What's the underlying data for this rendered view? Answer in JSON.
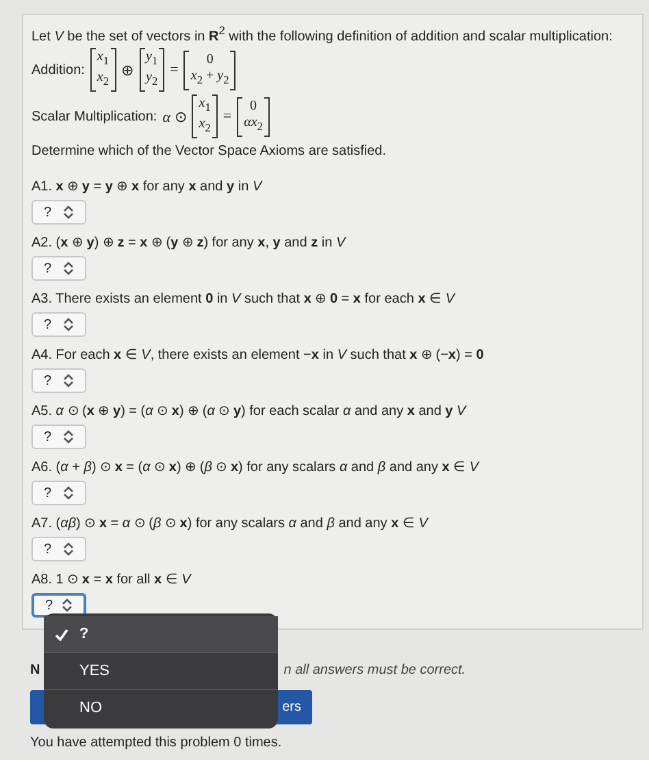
{
  "intro": "Let *V* be the set of vectors in **R**$^{2}$ with the following definition of addition and scalar multiplication:",
  "definitions": [
    {
      "label": "Addition:",
      "terms": [
        {
          "kind": "matrix",
          "entries": [
            "*x*$_{1}$",
            "*x*$_{2}$"
          ]
        },
        {
          "kind": "symbol",
          "text": "⊕"
        },
        {
          "kind": "matrix",
          "entries": [
            "*y*$_{1}$",
            "*y*$_{2}$"
          ]
        },
        {
          "kind": "symbol",
          "text": "="
        },
        {
          "kind": "matrix",
          "entries": [
            "0",
            "*x*$_{2}$ + *y*$_{2}$"
          ]
        }
      ]
    },
    {
      "label": "Scalar Multiplication:",
      "terms": [
        {
          "kind": "symbol",
          "text": "*α* ⊙"
        },
        {
          "kind": "matrix",
          "entries": [
            "*x*$_{1}$",
            "*x*$_{2}$"
          ]
        },
        {
          "kind": "symbol",
          "text": "="
        },
        {
          "kind": "matrix",
          "entries": [
            "0",
            "*αx*$_{2}$"
          ]
        }
      ]
    }
  ],
  "instruction": "Determine which of the Vector Space Axioms are satisfied.",
  "axioms": [
    {
      "text": "A1. **x** ⊕ **y** = **y** ⊕ **x** for any **x** and **y** in *V*",
      "answer": "?",
      "focused": false
    },
    {
      "text": "A2. (**x** ⊕ **y**) ⊕ **z** = **x** ⊕ (**y** ⊕ **z**) for any **x**, **y** and **z** in *V*",
      "answer": "?",
      "focused": false
    },
    {
      "text": "A3. There exists an element **0** in *V* such that **x** ⊕ **0** = **x** for each **x** ∈ *V*",
      "answer": "?",
      "focused": false
    },
    {
      "text": "A4. For each **x** ∈ *V*, there exists an element −**x** in *V* such that **x** ⊕ (−**x**) = **0**",
      "answer": "?",
      "focused": false
    },
    {
      "text": "A5. *α* ⊙ (**x** ⊕ **y**) = (*α* ⊙ **x**) ⊕ (*α* ⊙ **y**) for each scalar *α* and any **x** and **y** *V*",
      "answer": "?",
      "focused": false
    },
    {
      "text": "A6. (*α* + *β*) ⊙ **x** = (*α* ⊙ **x**) ⊕ (*β* ⊙ **x**) for any scalars *α* and *β* and any **x** ∈ *V*",
      "answer": "?",
      "focused": false
    },
    {
      "text": "A7. (*αβ*) ⊙ **x** = *α* ⊙ (*β* ⊙ **x**) for any scalars *α* and *β* and any **x** ∈ *V*",
      "answer": "?",
      "focused": false
    },
    {
      "text": "A8. 1 ⊙ **x** = **x** for all **x** ∈ *V*",
      "answer": "?",
      "focused": true
    }
  ],
  "note_start": "N",
  "note_end": "n all answers must be correct.",
  "submit_button": "ers",
  "attempts": "You have attempted this problem 0 times.",
  "dropdown": {
    "options": [
      {
        "label": "?",
        "selected": true
      },
      {
        "label": "YES",
        "selected": false
      },
      {
        "label": "NO",
        "selected": false
      }
    ]
  }
}
